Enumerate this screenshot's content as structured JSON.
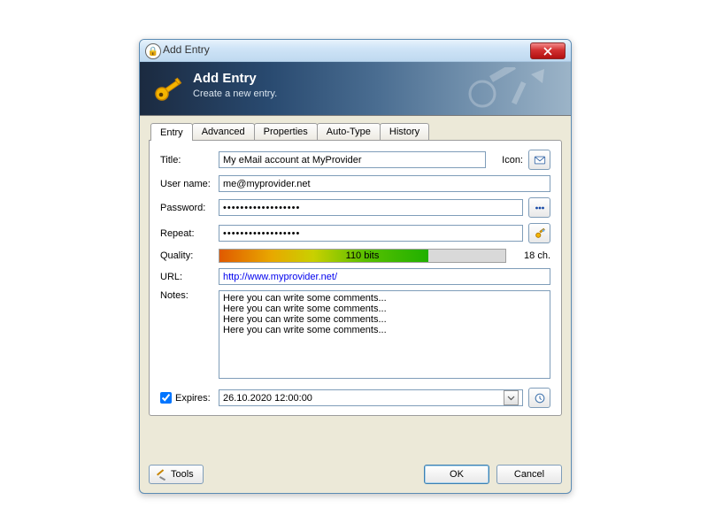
{
  "window": {
    "title": "Add Entry"
  },
  "banner": {
    "title": "Add Entry",
    "subtitle": "Create a new entry."
  },
  "tabs": [
    "Entry",
    "Advanced",
    "Properties",
    "Auto-Type",
    "History"
  ],
  "labels": {
    "title": "Title:",
    "icon": "Icon:",
    "username": "User name:",
    "password": "Password:",
    "repeat": "Repeat:",
    "quality": "Quality:",
    "url": "URL:",
    "notes": "Notes:",
    "expires": "Expires:"
  },
  "fields": {
    "title": "My eMail account at MyProvider",
    "username": "me@myprovider.net",
    "password": "••••••••••••••••••",
    "repeat": "••••••••••••••••••",
    "quality_text": "110 bits",
    "chars": "18 ch.",
    "url": "http://www.myprovider.net/",
    "notes": "Here you can write some comments...\nHere you can write some comments...\nHere you can write some comments...\nHere you can write some comments...",
    "expires": "26.10.2020 12:00:00",
    "expires_checked": true
  },
  "footer": {
    "tools": "Tools",
    "ok": "OK",
    "cancel": "Cancel"
  }
}
